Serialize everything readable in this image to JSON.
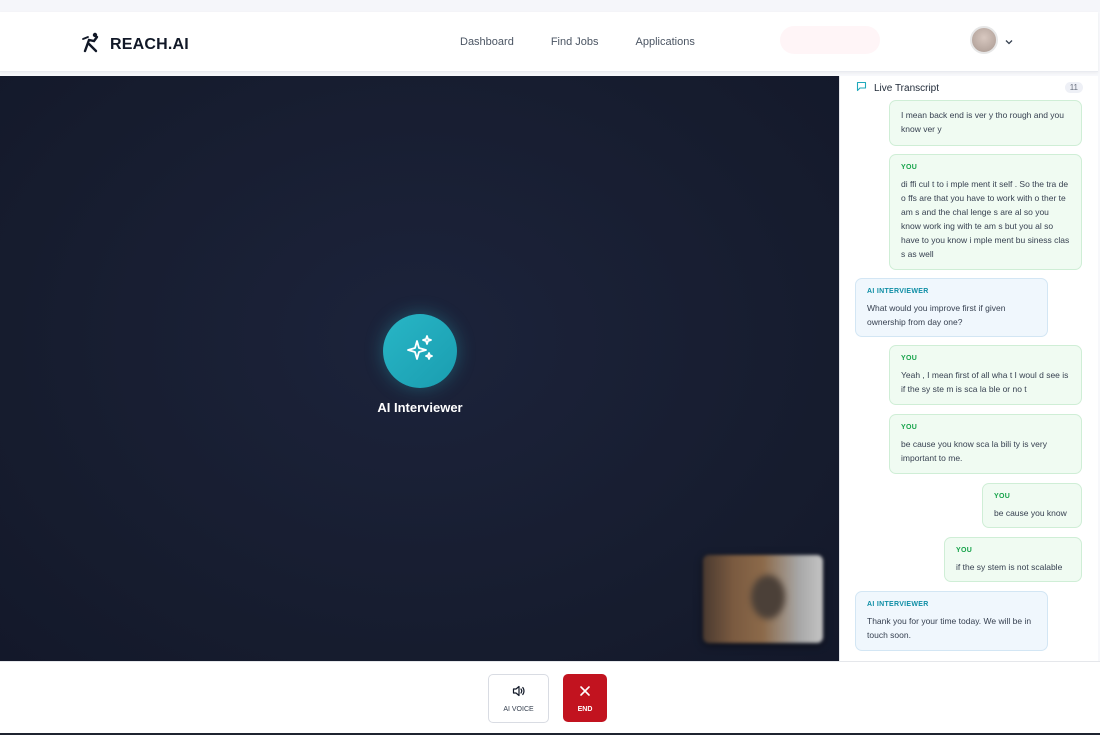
{
  "app": {
    "brand": "REACH.AI"
  },
  "nav": {
    "items": [
      "Dashboard",
      "Find Jobs",
      "Applications"
    ]
  },
  "stage": {
    "ai_label": "AI Interviewer"
  },
  "transcript": {
    "title": "Live Transcript",
    "count": "11",
    "messages": [
      {
        "role": "",
        "text": "I mean back end is ver y tho rough and you know ver y"
      },
      {
        "role": "YOU",
        "text": "di ffi cul t to i mple ment it self . So the tra de o ffs are that you have to work with o ther te am s and the chal lenge s are al so you know work ing with te am s but you al so have to you know i mple ment bu siness clas s as well"
      },
      {
        "role": "AI INTERVIEWER",
        "text": "What would you improve first if given ownership from day one?"
      },
      {
        "role": "YOU",
        "text": "Yeah , I mean first of all wha t I woul d see is if the sy ste m is sca la ble or no t"
      },
      {
        "role": "YOU",
        "text": "be cause you know sca la bili ty is very important to me."
      },
      {
        "role": "YOU",
        "text": "be cause you know"
      },
      {
        "role": "YOU",
        "text": "if the sy stem is not scalable"
      },
      {
        "role": "AI INTERVIEWER",
        "text": "Thank you for your time today. We will be in touch soon."
      }
    ]
  },
  "controls": {
    "voice_label": "AI VOICE",
    "end_label": "END"
  },
  "colors": {
    "accent": "#1fa9bb",
    "end": "#c2131f",
    "stage_bg": "#161c2e"
  }
}
